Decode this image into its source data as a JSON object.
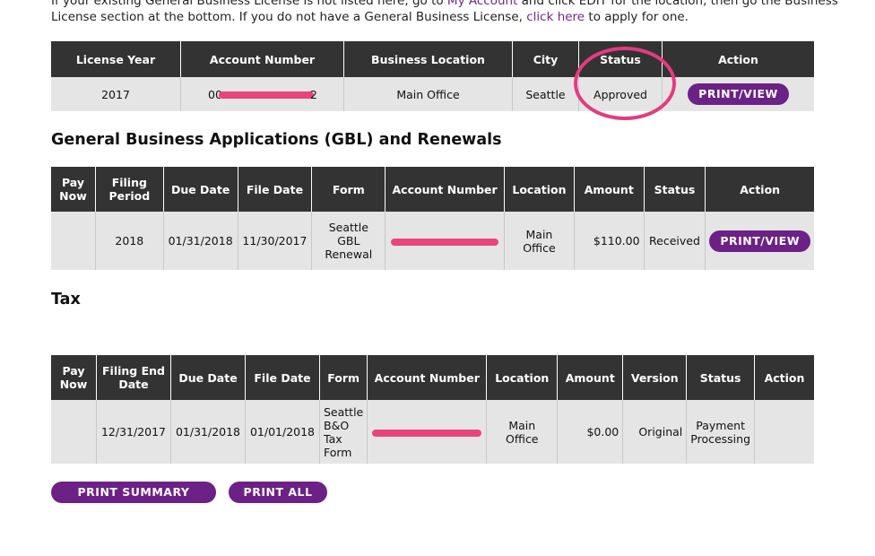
{
  "intro": {
    "line1_pre": "If your existing General Business License is not listed here, go to ",
    "my_account_link": "My Account",
    "line1_post": " and click EDIT for the location, then go the Business",
    "line2_pre": "License section at the bottom. If you do not have a General Business License, ",
    "click_here_link": "click here",
    "line2_post": " to apply for one."
  },
  "license_table": {
    "headers": [
      "License Year",
      "Account Number",
      "Business Location",
      "City",
      "Status",
      "Action"
    ],
    "row": {
      "year": "2017",
      "account_prefix": "00",
      "account_suffix": "2",
      "location": "Main Office",
      "city": "Seattle",
      "status": "Approved",
      "action": "PRINT/VIEW"
    }
  },
  "gbl_section": {
    "title": "General Business Applications (GBL) and Renewals",
    "headers": [
      "Pay Now",
      "Filing Period",
      "Due Date",
      "File Date",
      "Form",
      "Account Number",
      "Location",
      "Amount",
      "Status",
      "Action"
    ],
    "row": {
      "pay_now": "",
      "filing_period": "2018",
      "due_date": "01/31/2018",
      "file_date": "11/30/2017",
      "form": "Seattle GBL Renewal",
      "location": "Main Office",
      "amount": "$110.00",
      "status": "Received",
      "action": "PRINT/VIEW"
    }
  },
  "tax_section": {
    "title": "Tax",
    "headers": [
      "Pay Now",
      "Filing End Date",
      "Due Date",
      "File Date",
      "Form",
      "Account Number",
      "Location",
      "Amount",
      "Version",
      "Status",
      "Action"
    ],
    "row": {
      "pay_now": "",
      "filing_end_date": "12/31/2017",
      "due_date": "01/31/2018",
      "file_date": "01/01/2018",
      "form": "Seattle B&O Tax Form",
      "location": "Main Office",
      "amount": "$0.00",
      "version": "Original",
      "status": "Payment Processing",
      "action": ""
    }
  },
  "buttons": {
    "print_summary": "PRINT SUMMARY",
    "print_all": "PRINT ALL"
  },
  "colors": {
    "header_bg": "#333333",
    "row_bg": "#e5e5e5",
    "button_purple": "#6b2185",
    "annotation_pink": "#e23c7f"
  }
}
